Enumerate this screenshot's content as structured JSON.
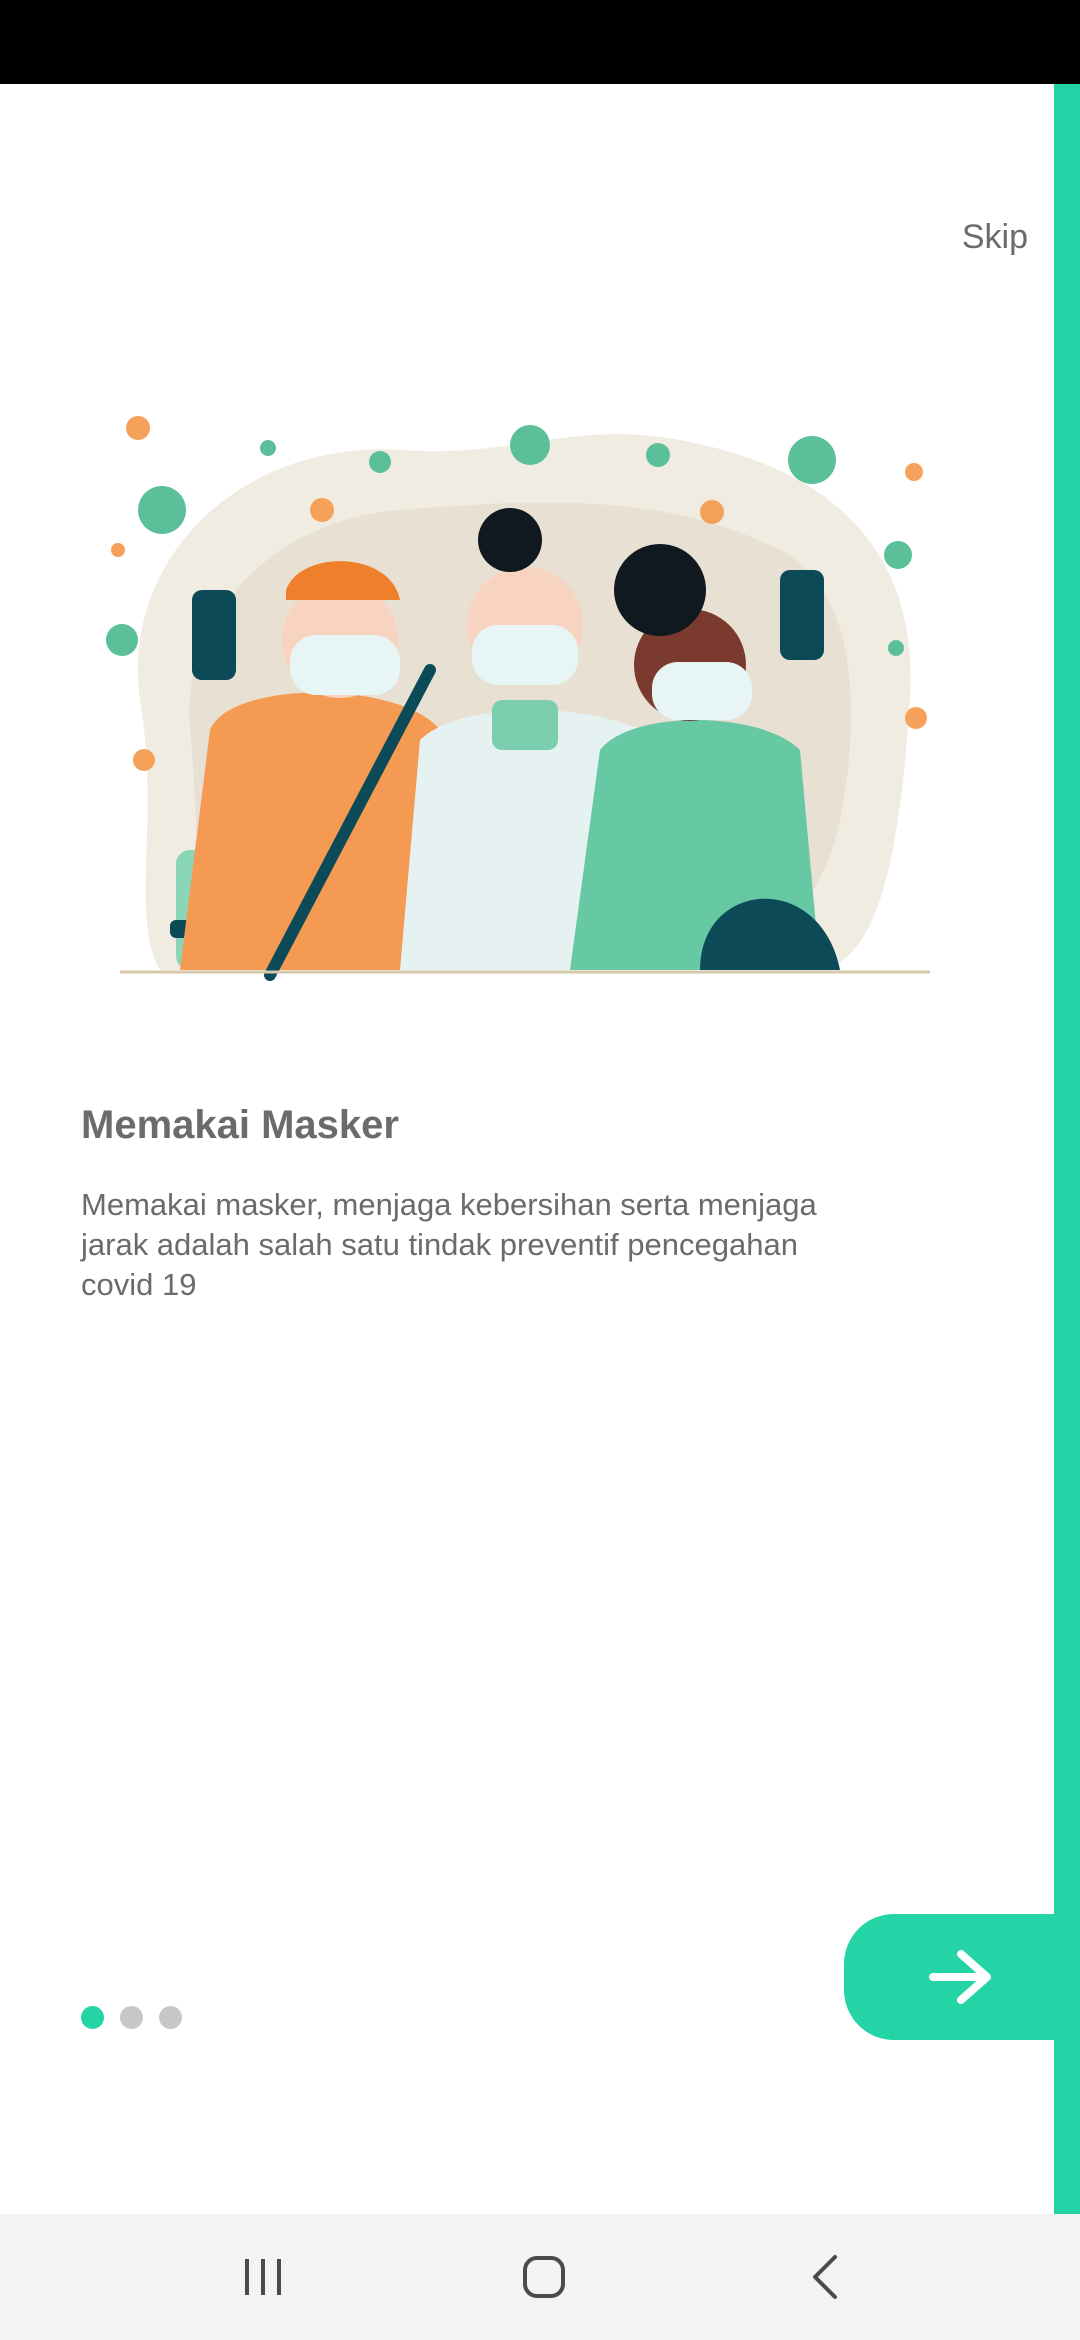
{
  "onboarding": {
    "skip_label": "Skip",
    "title": "Memakai Masker",
    "description": "Memakai masker, menjaga kebersihan serta menjaga jarak adalah salah satu tindak preventif pencegahan covid 19",
    "page_indicator": {
      "current": 1,
      "total": 3
    },
    "next_icon": "arrow-right-icon",
    "illustration": "cleaning-crew-masks-illustration"
  },
  "navigation": {
    "recent_icon": "recent-apps-icon",
    "home_icon": "home-icon",
    "back_icon": "back-icon"
  },
  "colors": {
    "accent": "#24d3a6",
    "text": "#6b6b6b",
    "dot_inactive": "#c7c7c7",
    "nav_bg": "#f3f3f3"
  }
}
